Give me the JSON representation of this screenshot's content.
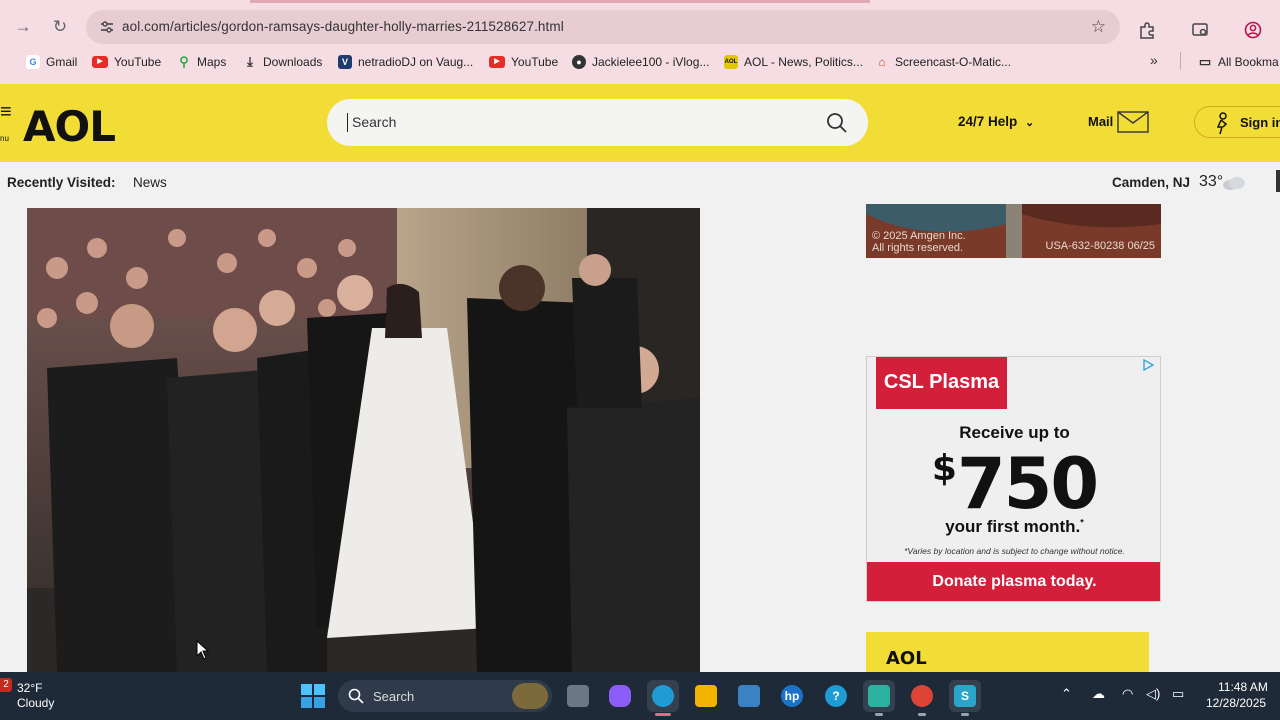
{
  "browser": {
    "url": "aol.com/articles/gordon-ramsays-daughter-holly-marries-211528627.html",
    "bookmarks": [
      {
        "label": "Gmail",
        "icon": "gmail-icon",
        "color": "#4285f4"
      },
      {
        "label": "YouTube",
        "icon": "youtube-icon",
        "color": "#e52d27"
      },
      {
        "label": "Maps",
        "icon": "maps-icon",
        "color": "#34a853"
      },
      {
        "label": "Downloads",
        "icon": "download-icon",
        "color": "#333333"
      },
      {
        "label": "netradioDJ on Vaug...",
        "icon": "netradio-icon",
        "color": "#1e3a6e"
      },
      {
        "label": "YouTube",
        "icon": "youtube-icon",
        "color": "#e52d27"
      },
      {
        "label": "Jackielee100 - iVlog...",
        "icon": "ivlog-icon",
        "color": "#333333"
      },
      {
        "label": "AOL - News, Politics...",
        "icon": "aol-icon",
        "color": "#e2c800"
      },
      {
        "label": "Screencast-O-Matic...",
        "icon": "screencast-icon",
        "color": "#d44b1f"
      }
    ],
    "all_bookmarks": "All Bookma"
  },
  "aol": {
    "menu_label": "nu",
    "logo": "AOL",
    "search_placeholder": "Search",
    "help": "24/7 Help",
    "mail": "Mail",
    "signin": "Sign in",
    "brand_yellow": "#f2dc36"
  },
  "recent": {
    "label": "Recently Visited:",
    "items": [
      "News"
    ],
    "location": "Camden, NJ",
    "temp": "33°"
  },
  "ads": {
    "top": {
      "line1": "© 2025 Amgen Inc.",
      "line2": "All rights reserved.",
      "code": "USA-632-80238  06/25"
    },
    "csl": {
      "brand": "CSL Plasma",
      "line1": "Receive up to",
      "dollar": "$",
      "amount": "750",
      "line2": "your first month.",
      "note": "*Varies by location and is subject to change without notice.",
      "cta": "Donate plasma today.",
      "brand_color": "#d41f3b"
    },
    "aol_logo": "AOL"
  },
  "taskbar": {
    "badge": "2",
    "temp": "32°F",
    "condition": "Cloudy",
    "search": "Search",
    "time": "11:48 AM",
    "date": "12/28/2025"
  }
}
